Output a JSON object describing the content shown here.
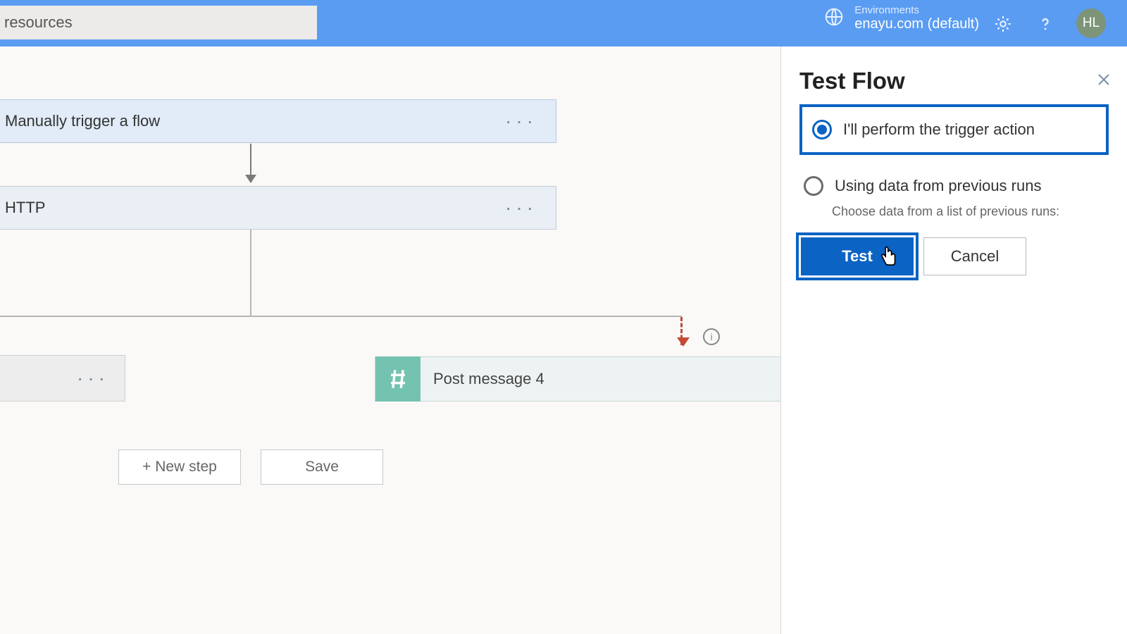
{
  "header": {
    "search_text": "resources",
    "env_label": "Environments",
    "env_value": "enayu.com (default)",
    "avatar_initials": "HL"
  },
  "flow": {
    "trigger_label": "Manually trigger a flow",
    "http_label": "HTTP",
    "post_label": "Post message 4",
    "new_step": "+ New step",
    "save": "Save"
  },
  "panel": {
    "title": "Test Flow",
    "option_manual": "I'll perform the trigger action",
    "option_prev": "Using data from previous runs",
    "option_prev_sub": "Choose data from a list of previous runs:",
    "btn_test": "Test",
    "btn_cancel": "Cancel"
  }
}
